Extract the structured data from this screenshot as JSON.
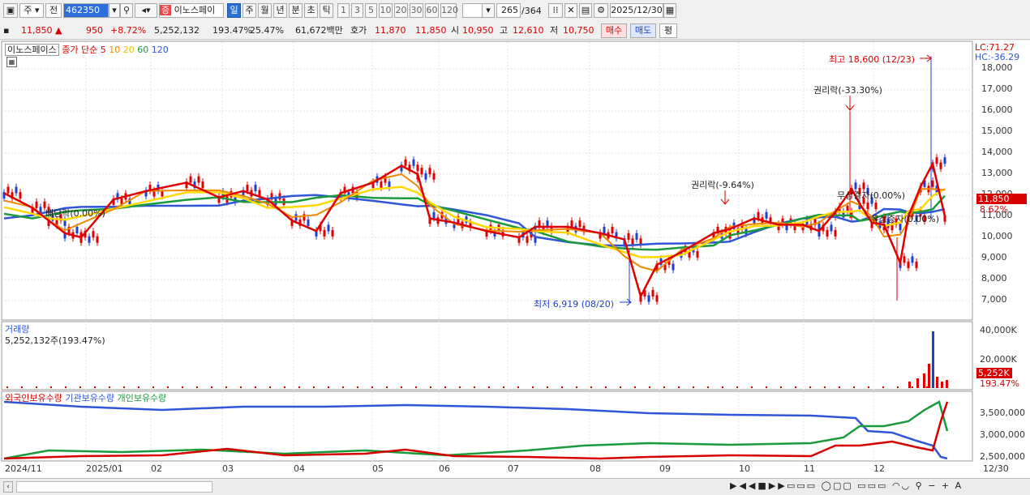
{
  "toolbar": {
    "market": "주",
    "mode": "전",
    "code": "462350",
    "company": "이노스페이",
    "badge": "증",
    "periods": [
      "일",
      "주",
      "월",
      "년",
      "분",
      "초",
      "틱"
    ],
    "intervals": [
      "1",
      "3",
      "5",
      "10",
      "20",
      "30",
      "60",
      "120"
    ],
    "count": "265",
    "total": "/364",
    "date": "2025/12/30"
  },
  "quote": {
    "price": "11,850",
    "change": "950",
    "pct": "+8.72%",
    "volume": "5,252,132",
    "vol_ratio": "193.47%",
    "turnover": "25.47%",
    "amount": "61,672백만",
    "hoga_label": "호가",
    "hoga_ask": "11,870",
    "hoga_bid": "11,850",
    "open_label": "시",
    "open": "10,950",
    "high_label": "고",
    "high": "12,610",
    "low_label": "저",
    "low": "10,750",
    "buy": "매수",
    "sell": "매도",
    "eval": "평"
  },
  "legend": {
    "name": "이노스페이스",
    "type": "종가 단순",
    "ma": [
      "5",
      "10",
      "20",
      "60",
      "120"
    ]
  },
  "price_axis": {
    "ticks": [
      "18,000",
      "17,000",
      "16,000",
      "15,000",
      "14,000",
      "13,000",
      "12,000",
      "11,000",
      "10,000",
      "9,000",
      "8,000",
      "7,000"
    ],
    "lc": "LC:71.27",
    "hc": "HC:-36.29",
    "cur": "11,850",
    "cur_pct": "8.62%"
  },
  "annotations": {
    "high": "최고 18,600 (12/23)",
    "low": "최저 6,919 (08/20)",
    "exright1": "권리락(-33.30%)",
    "exright2": "권리락(-9.64%)",
    "div": "배당락(0.00%)",
    "ann1": "무상증자(0.00%)",
    "ann2": "유상증자(0.00%)"
  },
  "volume_panel": {
    "title": "거래량",
    "value": "5,252,132주(193.47%)",
    "ticks": [
      "40,000K",
      "20,000K"
    ],
    "cur": "5,252K",
    "cur_pct": "193.47%"
  },
  "holder_panel": {
    "series": [
      "외국인보유수량",
      "기관보유수량",
      "개인보유수량"
    ],
    "ticks": [
      "3,500,000",
      "3,000,000",
      "2,500,000"
    ]
  },
  "x_axis": [
    "2024/11",
    "2025/01",
    "02",
    "03",
    "04",
    "05",
    "06",
    "07",
    "08",
    "09",
    "10",
    "11",
    "12",
    "12/30"
  ],
  "colors": {
    "ma5": "#e00000",
    "ma10": "#f08a00",
    "ma20": "#ffd800",
    "ma60": "#1a9a3a",
    "ma120": "#2f56d8",
    "up": "#e00000",
    "down": "#1f3fd0"
  }
}
